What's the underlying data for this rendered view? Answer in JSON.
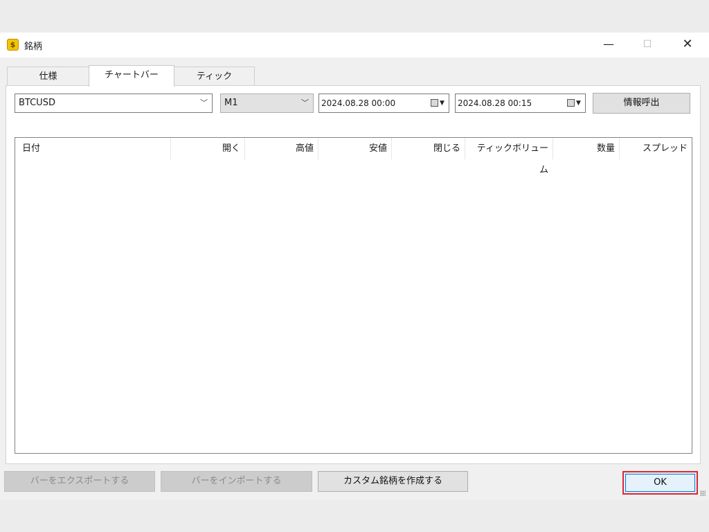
{
  "window": {
    "title": "銘柄",
    "app_icon": "dollar-icon"
  },
  "title_controls": {
    "minimize": "—",
    "maximize": "☐",
    "close": "✕"
  },
  "tabs": [
    {
      "label": "仕様",
      "active": false
    },
    {
      "label": "チャートバー",
      "active": true
    },
    {
      "label": "ティック",
      "active": false
    }
  ],
  "filters": {
    "symbol": "BTCUSD",
    "timeframe": "M1",
    "date_from": "2024.08.28 00:00",
    "date_to": "2024.08.28 00:15",
    "request_label": "情報呼出"
  },
  "table": {
    "columns": [
      "日付",
      "開く",
      "高値",
      "安値",
      "閉じる",
      "ティックボリューム",
      "数量",
      "スプレッド"
    ],
    "rows": []
  },
  "footer": {
    "export_label": "バーをエクスポートする",
    "import_label": "バーをインポートする",
    "custom_label": "カスタム銘柄を作成する",
    "ok_label": "OK"
  },
  "colors": {
    "highlight": "#e0262f",
    "focus": "#0078d7"
  }
}
